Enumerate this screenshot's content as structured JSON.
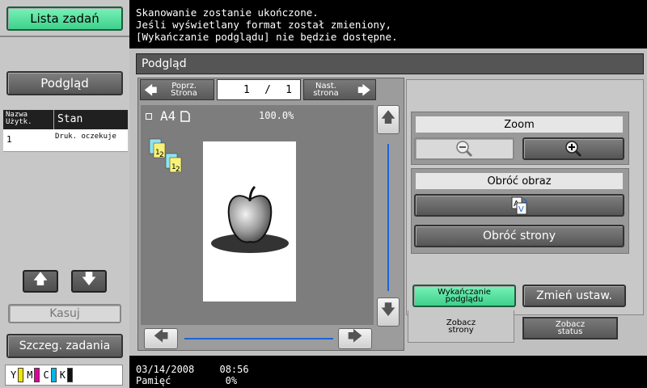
{
  "message": {
    "line1": "Skanowanie zostanie ukończone.",
    "line2": "Jeśli wyświetlany format został zmieniony,",
    "line3": "[Wykańczanie podglądu] nie będzie dostępne."
  },
  "left": {
    "job_list_button": "Lista zadań",
    "preview_button": "Podgląd",
    "table": {
      "col_user": "Nazwa Użytk.",
      "col_status": "Stan",
      "rows": [
        {
          "no": "1",
          "status": "Druk. oczekuje"
        }
      ]
    },
    "delete_button": "Kasuj",
    "details_button": "Szczeg. zadania",
    "toner": [
      {
        "label": "Y",
        "color": "#f2e600"
      },
      {
        "label": "M",
        "color": "#e0009a"
      },
      {
        "label": "C",
        "color": "#00b5e8"
      },
      {
        "label": "K",
        "color": "#111111"
      }
    ]
  },
  "window": {
    "title": "Podgląd",
    "prev_page": "Poprz. Strona",
    "next_page": "Nast. strona",
    "page_current": "1",
    "page_sep": "/",
    "page_total": "1",
    "paper_size": "A4",
    "zoom_level": "100.0%"
  },
  "right": {
    "zoom_label": "Zoom",
    "rotate_image_label": "Obróć obraz",
    "rotate_pages_button": "Obróć strony",
    "finishing_preview_button": "Wykańczanie podglądu",
    "change_settings_button": "Zmień ustaw.",
    "tab_pages": "Zobacz strony",
    "tab_status": "Zobacz status"
  },
  "status": {
    "date": "03/14/2008",
    "time": "08:56",
    "memory_label": "Pamięć",
    "memory_value": "0%"
  }
}
